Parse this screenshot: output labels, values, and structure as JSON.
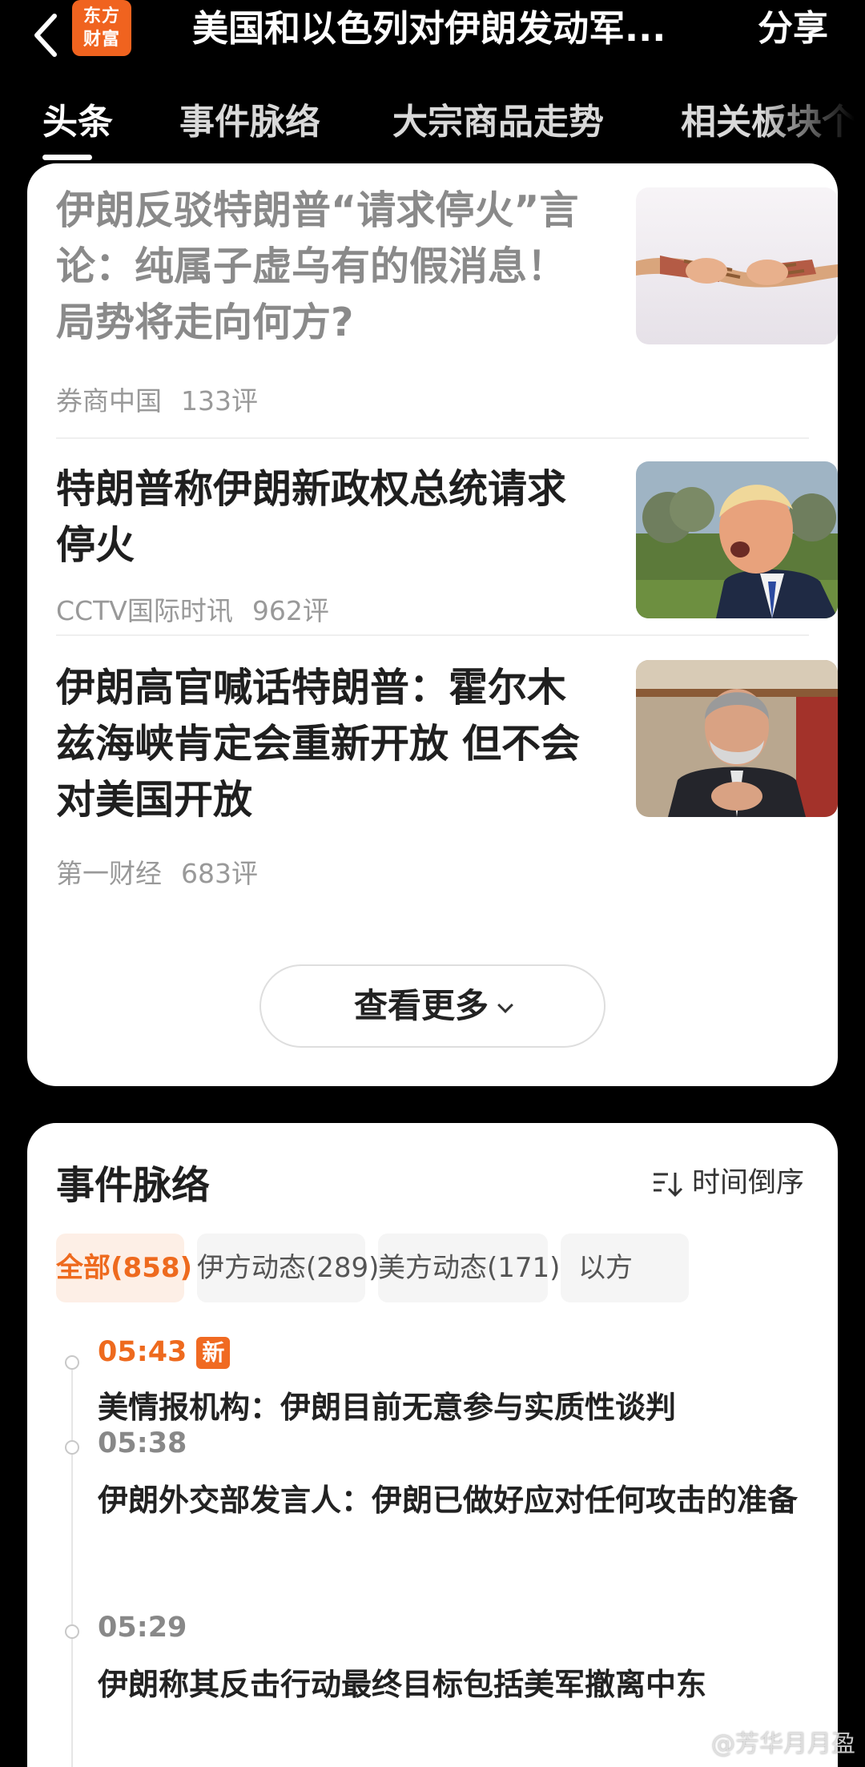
{
  "header": {
    "logo_line1": "东方",
    "logo_line2": "财富",
    "title": "美国和以色列对伊朗发动军...",
    "share_label": "分享"
  },
  "tabs": [
    {
      "label": "头条",
      "active": true
    },
    {
      "label": "事件脉络",
      "active": false
    },
    {
      "label": "大宗商品走势",
      "active": false
    },
    {
      "label": "相关板块个",
      "active": false
    }
  ],
  "news": [
    {
      "title": "伊朗反驳特朗普“请求停火”言论：纯属子虚乌有的假消息！局势将走向何方?",
      "source": "券商中国",
      "comments": "133评",
      "read": true,
      "image": "rope-tug-of-war"
    },
    {
      "title": "特朗普称伊朗新政权总统请求停火",
      "source": "CCTV国际时讯",
      "comments": "962评",
      "read": false,
      "image": "trump-portrait"
    },
    {
      "title": "伊朗高官喊话特朗普：霍尔木兹海峡肯定会重新开放 但不会对美国开放",
      "source": "第一财经",
      "comments": "683评",
      "read": false,
      "image": "iranian-official-portrait"
    }
  ],
  "more_button": "查看更多",
  "timeline": {
    "heading": "事件脉络",
    "sort_label": "时间倒序",
    "filters": [
      {
        "label": "全部(858)",
        "active": true
      },
      {
        "label": "伊方动态(289)",
        "active": false
      },
      {
        "label": "美方动态(171)",
        "active": false
      },
      {
        "label": "以方",
        "active": false
      }
    ],
    "events": [
      {
        "time": "05:43",
        "badge": "新",
        "text": "美情报机构：伊朗目前无意参与实质性谈判"
      },
      {
        "time": "05:38",
        "badge": "",
        "text": "伊朗外交部发言人：伊朗已做好应对任何攻击的准备"
      },
      {
        "time": "05:29",
        "badge": "",
        "text": "伊朗称其反击行动最终目标包括美军撤离中东"
      }
    ]
  },
  "watermark": "@芳华月月盈",
  "colors": {
    "accent": "#ee6a1e",
    "logo_bg": "#f0631f",
    "background": "#000000",
    "card": "#ffffff"
  }
}
